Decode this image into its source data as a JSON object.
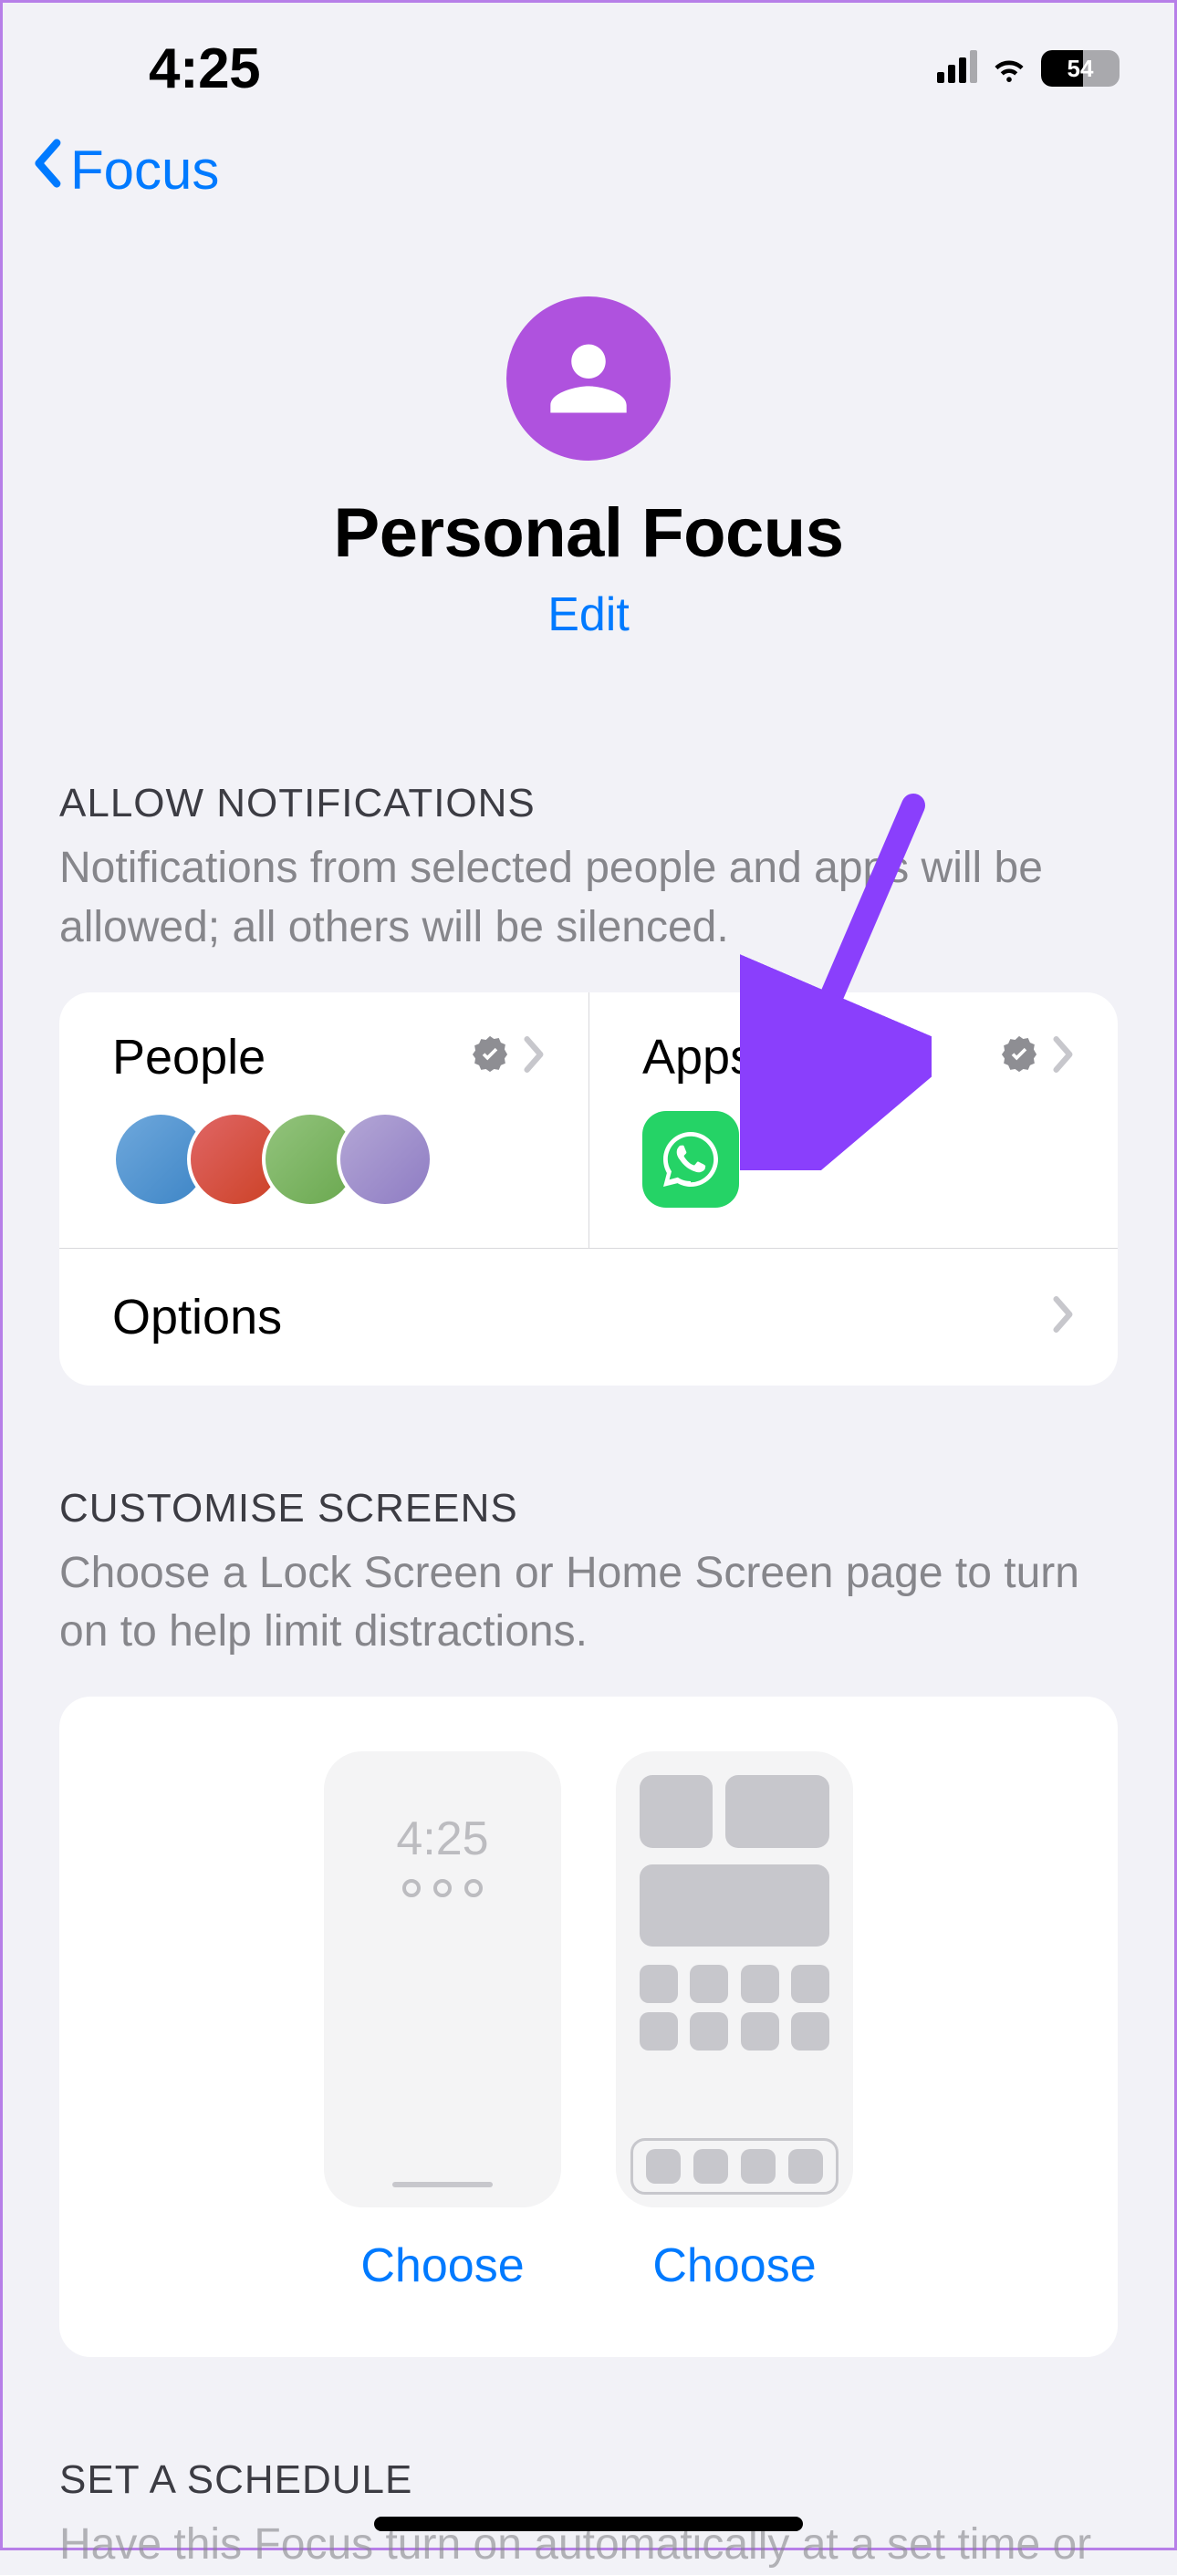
{
  "status": {
    "time": "4:25",
    "battery_percent": "54"
  },
  "nav": {
    "back_label": "Focus"
  },
  "header": {
    "title": "Personal Focus",
    "edit_label": "Edit"
  },
  "allow": {
    "section_label": "ALLOW NOTIFICATIONS",
    "section_desc": "Notifications from selected people and apps will be allowed; all others will be silenced.",
    "people_label": "People",
    "apps_label": "Apps",
    "options_label": "Options",
    "app_items": [
      "WhatsApp"
    ]
  },
  "customise": {
    "section_label": "CUSTOMISE SCREENS",
    "section_desc": "Choose a Lock Screen or Home Screen page to turn on to help limit distractions.",
    "lock_time": "4:25",
    "choose_label_lock": "Choose",
    "choose_label_home": "Choose"
  },
  "schedule": {
    "section_label": "SET A SCHEDULE",
    "section_desc": "Have this Focus turn on automatically at a set time or"
  }
}
